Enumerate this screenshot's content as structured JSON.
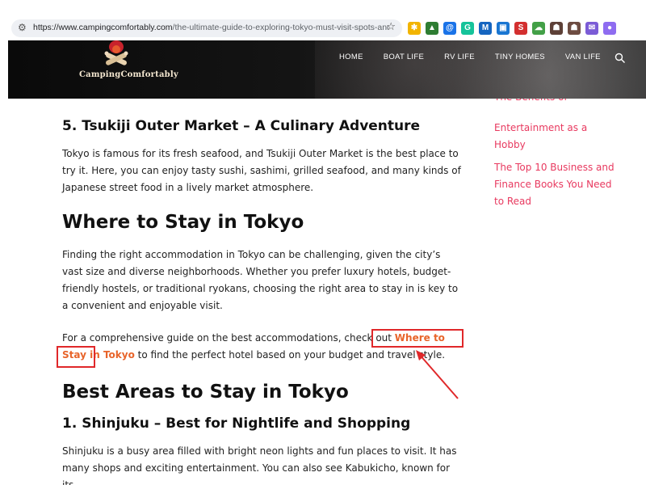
{
  "browser": {
    "site_info_icon": "tune-icon",
    "url_host": "https://www.campingcomfortably.com",
    "url_path": "/the-ultimate-guide-to-exploring-tokyo-must-visit-spots-and-acc...",
    "bookmark_icon": "star-icon",
    "extensions": [
      {
        "icon": "puzzle-icon",
        "glyph": "✱",
        "color": "#f2b400"
      },
      {
        "icon": "chart-icon",
        "glyph": "▲",
        "color": "#2e7d32"
      },
      {
        "icon": "at-icon",
        "glyph": "@",
        "color": "#1a73e8"
      },
      {
        "icon": "grammarly-icon",
        "glyph": "G",
        "color": "#15c39a"
      },
      {
        "icon": "mail-icon",
        "glyph": "M",
        "color": "#1565c0"
      },
      {
        "icon": "box-icon",
        "glyph": "▣",
        "color": "#1976d2"
      },
      {
        "icon": "s-icon",
        "glyph": "S",
        "color": "#d32f2f"
      },
      {
        "icon": "cloud-icon",
        "glyph": "☁",
        "color": "#43a047"
      },
      {
        "icon": "robot-icon",
        "glyph": "☗",
        "color": "#5d4037"
      },
      {
        "icon": "robot2-icon",
        "glyph": "☗",
        "color": "#6d4c41"
      },
      {
        "icon": "email-icon",
        "glyph": "✉",
        "color": "#7b5cd6"
      },
      {
        "icon": "chrome-icon",
        "glyph": "●",
        "color": "#8e6cf0"
      }
    ]
  },
  "header": {
    "logo_text": "CampingComfortably",
    "nav": [
      "HOME",
      "BOAT LIFE",
      "RV LIFE",
      "TINY HOMES",
      "VAN LIFE"
    ],
    "search_icon": "search-icon"
  },
  "article": {
    "h_tsukiji": "5. Tsukiji Outer Market – A Culinary Adventure",
    "p_tsukiji": "Tokyo is famous for its fresh seafood, and Tsukiji Outer Market is the best place to try it. Here, you can enjoy tasty sushi, sashimi, grilled seafood, and many kinds of Japanese street food in a lively market atmosphere.",
    "h_where": "Where to Stay in Tokyo",
    "p_where": "Finding the right accommodation in Tokyo can be challenging, given the city’s vast size and diverse neighborhoods. Whether you prefer luxury hotels, budget-friendly hostels, or traditional ryokans, choosing the right area to stay in is key to a convenient and enjoyable visit.",
    "p_guide_before": "For a comprehensive guide on the best accommodations, check out ",
    "p_guide_link": "Where to Stay in Tokyo",
    "p_guide_after": " to find the perfect hotel based on your budget and travel style.",
    "h_best": "Best Areas to Stay in Tokyo",
    "h_shinjuku": "1. Shinjuku – Best for Nightlife and Shopping",
    "p_shinjuku": "Shinjuku is a busy area filled with bright neon lights and fun places to visit. It has many shops and exciting entertainment. You can also see Kabukicho, known for its"
  },
  "sidebar": {
    "clipped_link": "The Benefits of",
    "link_1": "Entertainment as a Hobby",
    "link_2": "The Top 10 Business and Finance Books You Need to Read"
  },
  "colors": {
    "accent_link": "#e8642a",
    "sidebar_link": "#e8395f",
    "highlight": "#e0282a"
  }
}
